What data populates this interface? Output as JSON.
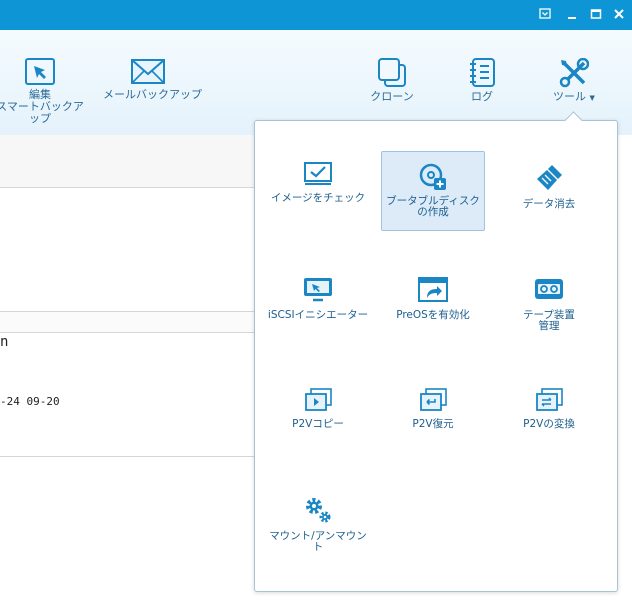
{
  "toolbar": {
    "items": [
      {
        "label": "編集\nスマートバックアップ",
        "icon": "cursor-arrow-icon"
      },
      {
        "label": "メールバックアップ",
        "icon": "envelope-icon"
      },
      {
        "label": "クローン",
        "icon": "clone-icon"
      },
      {
        "label": "ログ",
        "icon": "log-notebook-icon"
      },
      {
        "label": "ツール",
        "icon": "wrench-screwdriver-icon"
      }
    ]
  },
  "background": {
    "fragment_1": "n",
    "fragment_2": "-24 09-20"
  },
  "tools_menu": {
    "items": [
      {
        "label": "イメージをチェック",
        "icon": "check-image-icon"
      },
      {
        "label": "ブータブルディスク\nの作成",
        "icon": "bootable-disc-icon"
      },
      {
        "label": "データ消去",
        "icon": "data-wipe-brush-icon"
      },
      {
        "label": "iSCSIイニシエーター",
        "icon": "iscsi-monitor-icon"
      },
      {
        "label": "PreOSを有効化",
        "icon": "preos-window-icon"
      },
      {
        "label": "テープ装置\n管理",
        "icon": "tape-device-icon"
      },
      {
        "label": "P2Vコピー",
        "icon": "p2v-copy-icon"
      },
      {
        "label": "P2V復元",
        "icon": "p2v-restore-icon"
      },
      {
        "label": "P2Vの変換",
        "icon": "p2v-convert-icon"
      },
      {
        "label": "マウント/アンマウント",
        "icon": "mount-gears-icon"
      }
    ]
  },
  "colors": {
    "titlebar": "#0e95d6",
    "icon_blue": "#1a86c4",
    "selected_bg": "#dcebf7",
    "selected_border": "#9dc4e4"
  }
}
